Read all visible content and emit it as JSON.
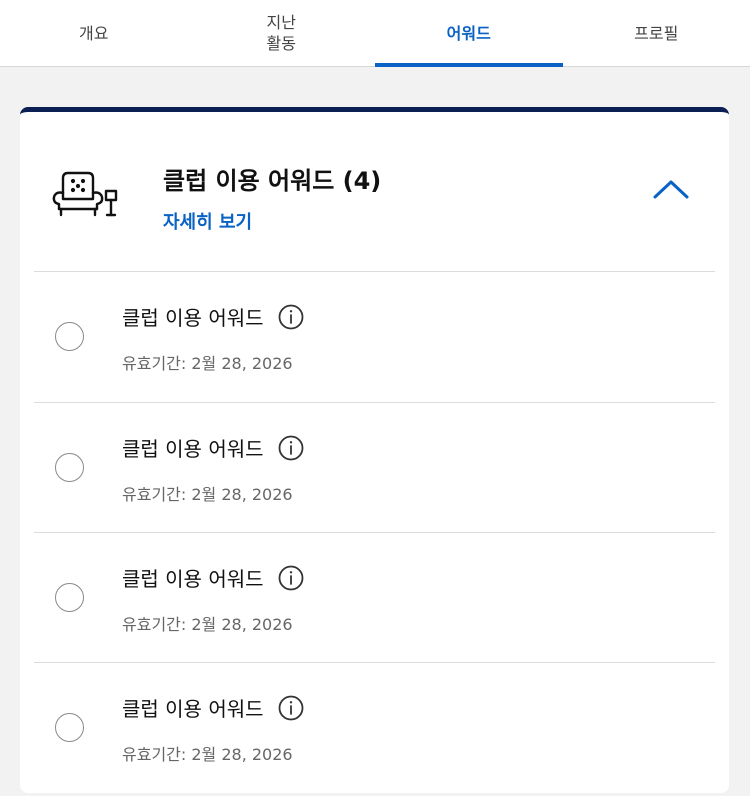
{
  "tabs": [
    {
      "label": "개요",
      "active": false
    },
    {
      "label": "지난\n활동",
      "active": false
    },
    {
      "label": "어워드",
      "active": true
    },
    {
      "label": "프로필",
      "active": false
    }
  ],
  "card": {
    "icon": "armchair-lamp-icon",
    "title": "클럽 이용 어워드 (4)",
    "details_link": "자세히 보기",
    "collapse_icon": "chevron-up-icon"
  },
  "awards": [
    {
      "title": "클럽 이용 어워드",
      "expiry": "유효기간: 2월 28, 2026"
    },
    {
      "title": "클럽 이용 어워드",
      "expiry": "유효기간: 2월 28, 2026"
    },
    {
      "title": "클럽 이용 어워드",
      "expiry": "유효기간: 2월 28, 2026"
    },
    {
      "title": "클럽 이용 어워드",
      "expiry": "유효기간: 2월 28, 2026"
    }
  ],
  "colors": {
    "accent": "#0a62c4",
    "card_top_border": "#0b1f54"
  }
}
